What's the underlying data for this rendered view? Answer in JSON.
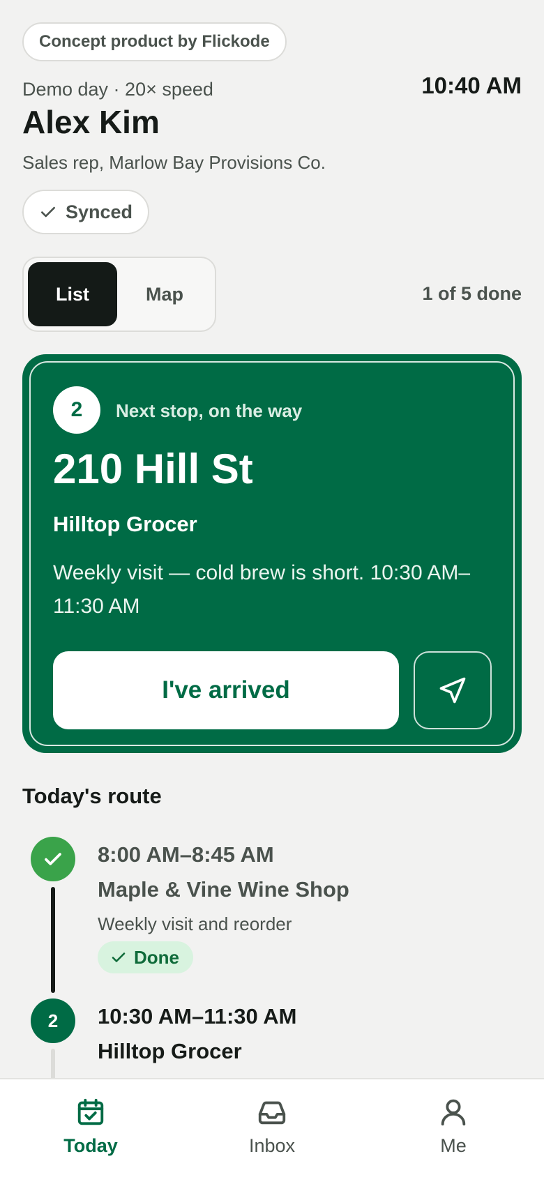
{
  "badge": {
    "concept": "Concept product by Flickode"
  },
  "header": {
    "meta": "Demo day · 20× speed",
    "clock": "10:40 AM",
    "name": "Alex Kim",
    "role": "Sales rep, Marlow Bay Provisions Co.",
    "sync_status": "Synced"
  },
  "view_toggle": {
    "list": "List",
    "map": "Map",
    "active": "List"
  },
  "progress": "1 of 5 done",
  "next_stop": {
    "number": "2",
    "kicker": "Next stop, on the way",
    "address": "210 Hill St",
    "name": "Hilltop Grocer",
    "note": "Weekly visit — cold brew is short. 10:30 AM–11:30 AM",
    "arrive_label": "I've arrived",
    "navigate_icon": "navigate-arrow-icon"
  },
  "route": {
    "title": "Today's route",
    "items": [
      {
        "marker": "check",
        "time": "8:00 AM–8:45 AM",
        "name": "Maple & Vine Wine Shop",
        "desc": "Weekly visit and reorder",
        "status": "Done"
      },
      {
        "marker": "2",
        "time": "10:30 AM–11:30 AM",
        "name": "Hilltop Grocer"
      }
    ]
  },
  "tabbar": {
    "tabs": [
      {
        "label": "Today",
        "icon": "calendar-check-icon",
        "active": true
      },
      {
        "label": "Inbox",
        "icon": "inbox-tray-icon",
        "active": false
      },
      {
        "label": "Me",
        "icon": "person-icon",
        "active": false
      }
    ]
  },
  "colors": {
    "brand_green": "#006b45",
    "done_green": "#3aa34a",
    "done_badge_bg": "#d8f3df",
    "background": "#f2f2f1",
    "ink": "#161b18"
  }
}
